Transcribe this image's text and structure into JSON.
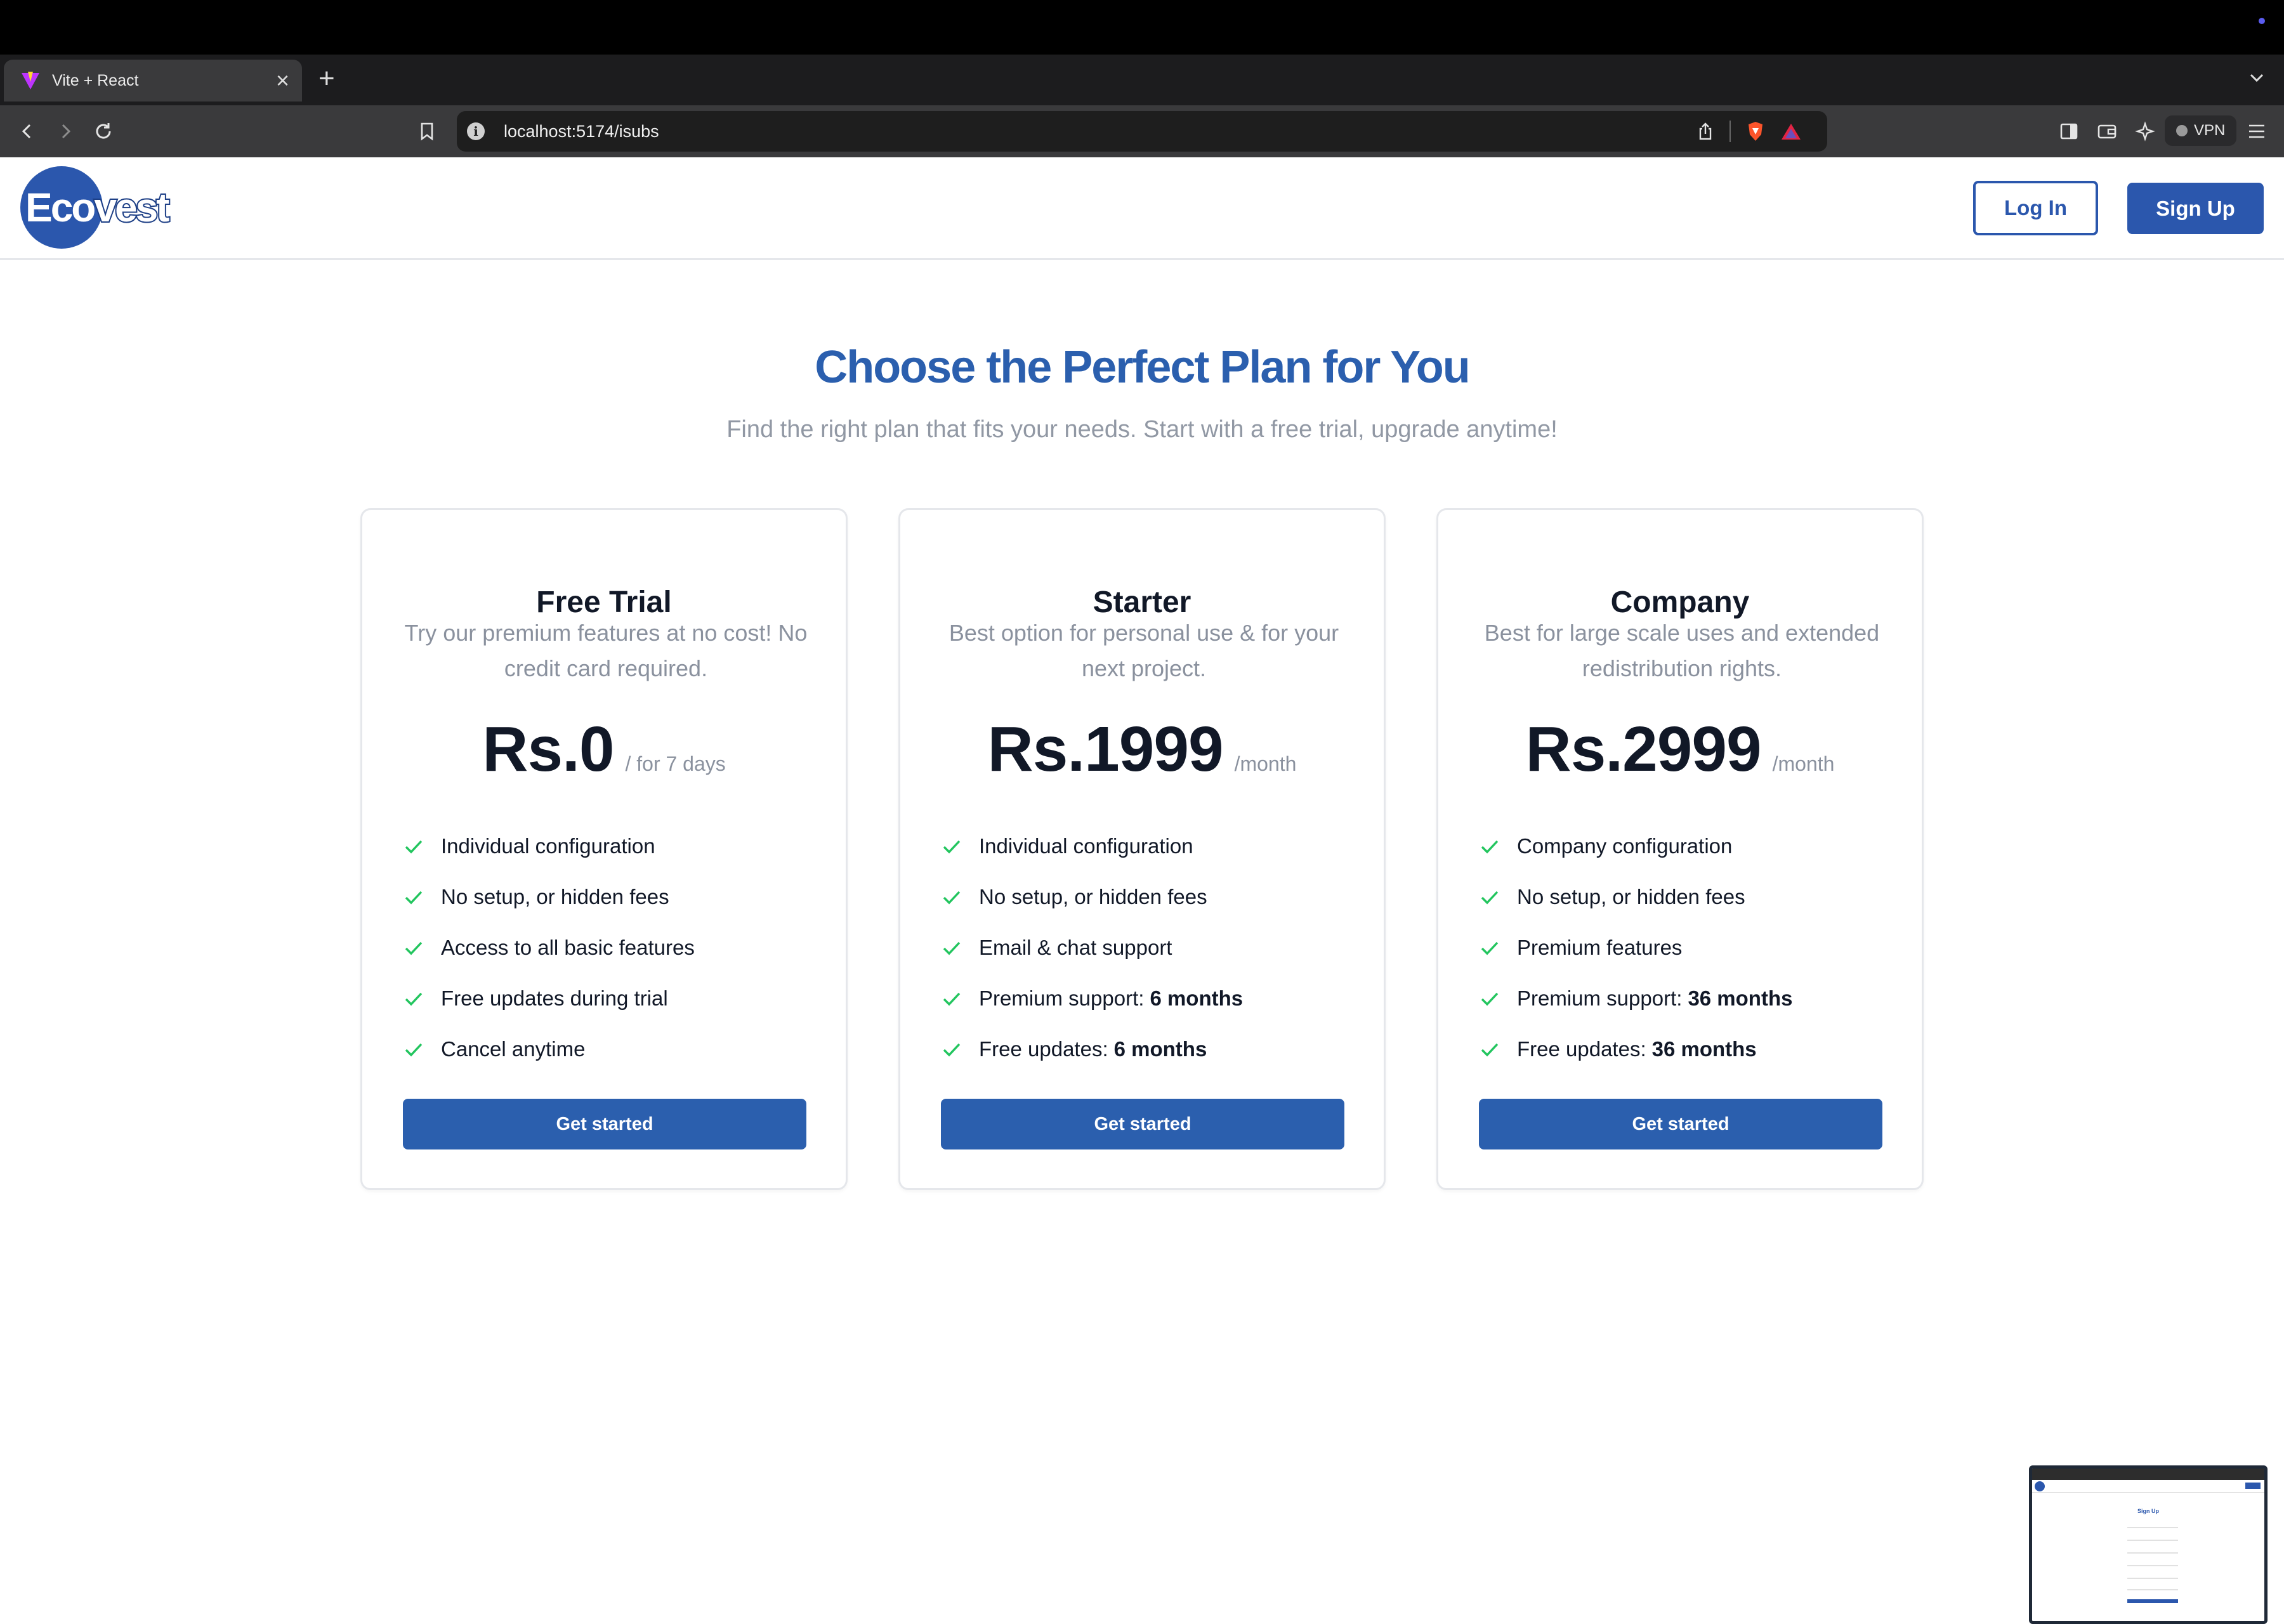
{
  "browser": {
    "tab_title": "Vite + React",
    "new_tab_symbol": "+",
    "close_symbol": "×",
    "url": "localhost:5174/isubs",
    "vpn_label": "VPN"
  },
  "header": {
    "logo_text_main": "Eco",
    "logo_text_rest": "vest",
    "login_label": "Log In",
    "signup_label": "Sign Up",
    "brand_color": "#2b57ad"
  },
  "hero": {
    "title": "Choose the Perfect Plan for You",
    "subtitle": "Find the right plan that fits your needs. Start with a free trial, upgrade anytime!"
  },
  "plans": [
    {
      "name": "Free Trial",
      "description": "Try our premium features at no cost! No credit card required.",
      "price": "Rs.0",
      "period": "/ for 7 days",
      "features": [
        {
          "text": "Individual configuration",
          "bold": ""
        },
        {
          "text": "No setup, or hidden fees",
          "bold": ""
        },
        {
          "text": "Access to all basic features",
          "bold": ""
        },
        {
          "text": "Free updates during trial",
          "bold": ""
        },
        {
          "text": "Cancel anytime",
          "bold": ""
        }
      ],
      "cta": "Get started"
    },
    {
      "name": "Starter",
      "description": "Best option for personal use & for your next project.",
      "price": "Rs.1999",
      "period": "/month",
      "features": [
        {
          "text": "Individual configuration",
          "bold": ""
        },
        {
          "text": "No setup, or hidden fees",
          "bold": ""
        },
        {
          "text": "Email & chat support",
          "bold": ""
        },
        {
          "text": "Premium support:",
          "bold": "6 months"
        },
        {
          "text": "Free updates:",
          "bold": "6 months"
        }
      ],
      "cta": "Get started"
    },
    {
      "name": "Company",
      "description": "Best for large scale uses and extended redistribution rights.",
      "price": "Rs.2999",
      "period": "/month",
      "features": [
        {
          "text": "Company configuration",
          "bold": ""
        },
        {
          "text": "No setup, or hidden fees",
          "bold": ""
        },
        {
          "text": "Premium features",
          "bold": ""
        },
        {
          "text": "Premium support:",
          "bold": "36 months"
        },
        {
          "text": "Free updates:",
          "bold": "36 months"
        }
      ],
      "cta": "Get started"
    }
  ],
  "thumbnail": {
    "title": "Sign Up"
  },
  "colors": {
    "accent": "#2b5fae",
    "check": "#22c55e",
    "muted_text": "#8a919e"
  }
}
